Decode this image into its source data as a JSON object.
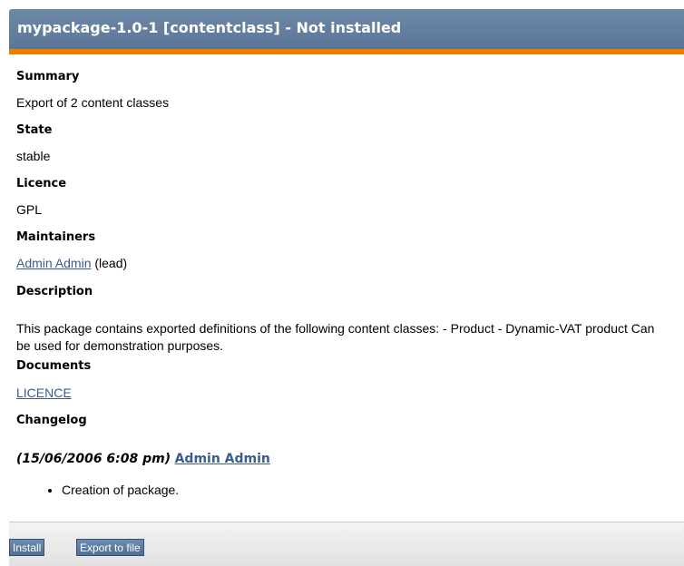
{
  "header": {
    "title": "mypackage-1.0-1 [contentclass] - Not installed"
  },
  "summary": {
    "label": "Summary",
    "value": "Export of 2 content classes"
  },
  "state": {
    "label": "State",
    "value": "stable"
  },
  "licence": {
    "label": "Licence",
    "value": "GPL"
  },
  "maintainers": {
    "label": "Maintainers",
    "name": "Admin Admin",
    "role": "(lead)"
  },
  "description": {
    "label": "Description",
    "text": "This package contains exported definitions of the following content classes: - Product - Dynamic-VAT product Can be used for demonstration purposes."
  },
  "documents": {
    "label": "Documents",
    "items": [
      "LICENCE"
    ]
  },
  "changelog": {
    "label": "Changelog",
    "date": "(15/06/2006 6:08 pm)",
    "author": "Admin Admin",
    "entries": [
      "Creation of package."
    ]
  },
  "buttons": {
    "install": "Install",
    "export": "Export to file"
  },
  "colors": {
    "header_bg": "#5f7b9c",
    "accent_stripe": "#ee7d00",
    "link": "#3a5b8c",
    "button_bg": "#5a7aa0"
  }
}
